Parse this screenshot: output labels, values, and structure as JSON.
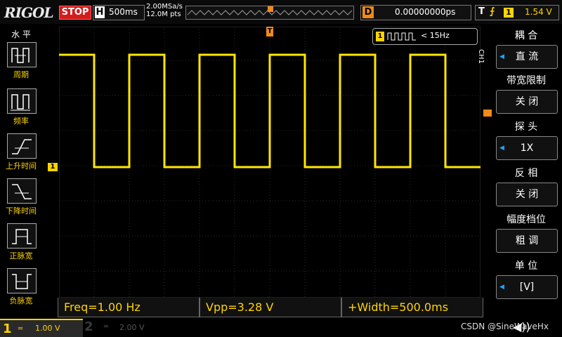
{
  "topbar": {
    "logo": "RIGOL",
    "run_state": "STOP",
    "horizontal_key": "H",
    "timebase": "500ms",
    "sample_rate": "2.00MSa/s",
    "memory_depth": "12.0M pts",
    "delay_key": "D",
    "delay_value": "0.00000000ps",
    "trigger_key": "T",
    "trigger_edge_symbol": "⨍",
    "trigger_channel": "1",
    "trigger_level": "1.54 V"
  },
  "left_menu": {
    "title": "水 平",
    "items": [
      {
        "label": "周期",
        "icon": "period-icon"
      },
      {
        "label": "频率",
        "icon": "frequency-icon"
      },
      {
        "label": "上升时间",
        "icon": "rise-time-icon"
      },
      {
        "label": "下降时间",
        "icon": "fall-time-icon"
      },
      {
        "label": "正脉宽",
        "icon": "positive-width-icon"
      },
      {
        "label": "负脉宽",
        "icon": "negative-width-icon"
      }
    ]
  },
  "screen": {
    "freq_counter_channel": "1",
    "freq_counter_text": "< 15Hz",
    "trigger_marker": "T",
    "ch1_marker": "1",
    "trace_color": "#ffe600"
  },
  "right_menu": {
    "channel_tag": "CH1",
    "sections": [
      {
        "header": "耦 合",
        "value": "直 流",
        "arrow": true
      },
      {
        "header": "带宽限制",
        "value": "关 闭",
        "arrow": false
      },
      {
        "header": "探 头",
        "value": "1X",
        "arrow": true
      },
      {
        "header": "反 相",
        "value": "关 闭",
        "arrow": false
      },
      {
        "header": "幅度档位",
        "value": "粗 调",
        "arrow": false
      },
      {
        "header": "单 位",
        "value": "[V]",
        "arrow": true
      }
    ]
  },
  "measurements": [
    {
      "label": "Freq=1.00 Hz"
    },
    {
      "label": "Vpp=3.28 V"
    },
    {
      "label": "+Width=500.0ms"
    }
  ],
  "bottom": {
    "ch1_number": "1",
    "ch1_scale": "1.00 V",
    "ch2_number": "2",
    "ch2_scale": "2.00 V",
    "watermark": "CSDN @SineWaveHx"
  }
}
